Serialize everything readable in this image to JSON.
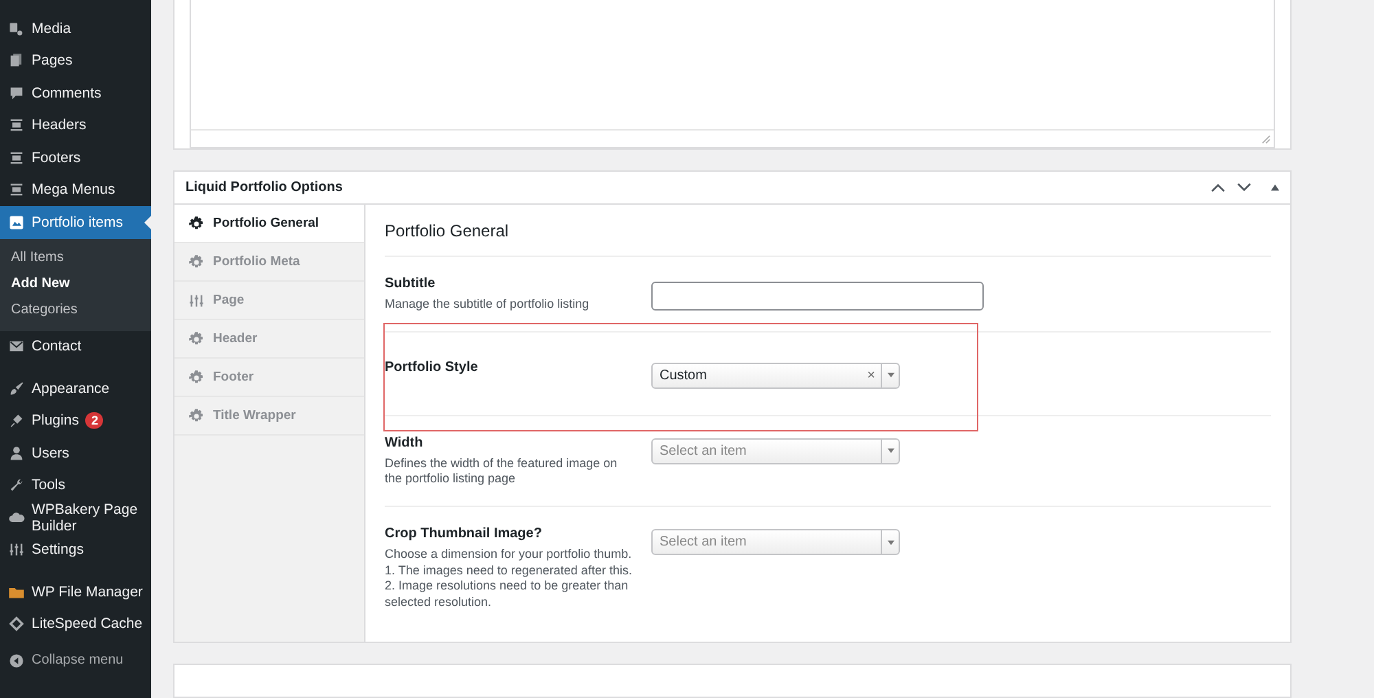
{
  "sidebar": {
    "groups": [
      [
        {
          "label": "Media",
          "selected": false
        },
        {
          "label": "Pages",
          "selected": false
        },
        {
          "label": "Comments",
          "selected": false
        },
        {
          "label": "Headers",
          "selected": false
        },
        {
          "label": "Footers",
          "selected": false
        },
        {
          "label": "Mega Menus",
          "selected": false
        },
        {
          "label": "Portfolio items",
          "selected": true,
          "children": [
            {
              "label": "All Items",
              "selected": false
            },
            {
              "label": "Add New",
              "selected": true
            },
            {
              "label": "Categories",
              "selected": false
            }
          ]
        },
        {
          "label": "Contact",
          "selected": false
        }
      ],
      [
        {
          "label": "Appearance",
          "selected": false
        },
        {
          "label": "Plugins",
          "selected": false,
          "badge": "2"
        },
        {
          "label": "Users",
          "selected": false
        },
        {
          "label": "Tools",
          "selected": false
        },
        {
          "label": "WPBakery Page Builder",
          "selected": false
        },
        {
          "label": "Settings",
          "selected": false
        }
      ],
      [
        {
          "label": "WP File Manager",
          "selected": false
        },
        {
          "label": "LiteSpeed Cache",
          "selected": false
        }
      ]
    ],
    "collapse": "Collapse menu"
  },
  "options_box": {
    "title": "Liquid Portfolio Options",
    "tabs": [
      {
        "label": "Portfolio General",
        "selected": true
      },
      {
        "label": "Portfolio Meta",
        "selected": false
      },
      {
        "label": "Page",
        "selected": false
      },
      {
        "label": "Header",
        "selected": false
      },
      {
        "label": "Footer",
        "selected": false
      },
      {
        "label": "Title Wrapper",
        "selected": false
      }
    ],
    "section_title": "Portfolio General",
    "fields": [
      {
        "kind": "text",
        "label": "Subtitle",
        "description": "Manage the subtitle of portfolio listing",
        "highlighted": false
      },
      {
        "kind": "select",
        "label": "Portfolio Style",
        "value": "Custom",
        "clear": "×",
        "highlighted": true
      },
      {
        "kind": "select",
        "label": "Width",
        "description": "Defines the width of the featured image on the portfolio listing page",
        "placeholder": "Select an item",
        "highlighted": false
      },
      {
        "kind": "select",
        "label": "Crop Thumbnail Image?",
        "description": "Choose a dimension for your portfolio thumb. 1. The images need to regenerated after this. 2. Image resolutions need to be greater than selected resolution.",
        "placeholder": "Select an item",
        "highlighted": false
      }
    ]
  }
}
